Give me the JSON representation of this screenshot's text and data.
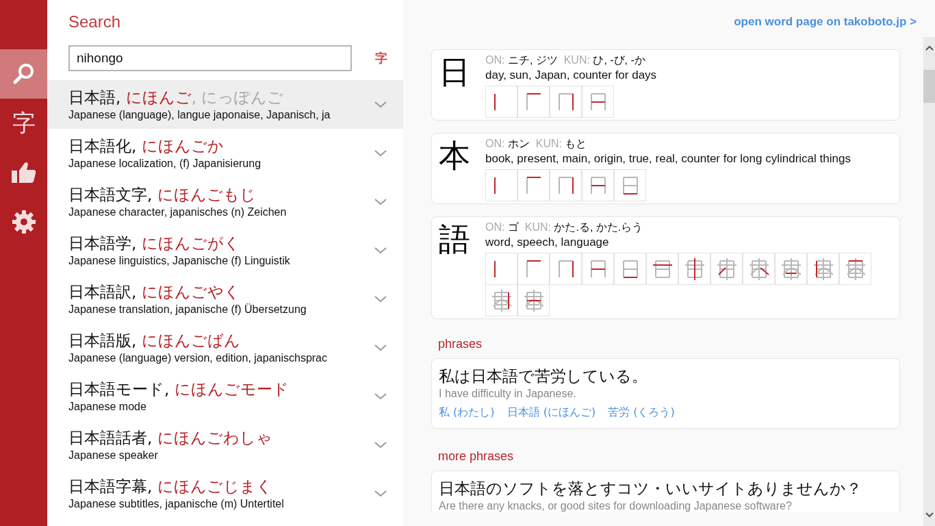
{
  "nav": [
    {
      "kind": "search",
      "selected": true
    },
    {
      "kind": "glyph",
      "label": "字",
      "selected": false
    },
    {
      "kind": "like",
      "selected": false
    },
    {
      "kind": "settings",
      "selected": false
    }
  ],
  "search": {
    "title": "Search",
    "value": "nihongo",
    "kanji_button": "字"
  },
  "results": [
    {
      "word": "日本語,",
      "reading": "にほんご",
      "alt_reading": ", にっぽんご",
      "meaning": "Japanese (language), langue japonaise, Japanisch, ja",
      "selected": true
    },
    {
      "word": "日本語化,",
      "reading": "にほんごか",
      "meaning": "Japanese localization, (f) Japanisierung",
      "selected": false
    },
    {
      "word": "日本語文字,",
      "reading": "にほんごもじ",
      "meaning": "Japanese character, japanisches (n) Zeichen",
      "selected": false
    },
    {
      "word": "日本語学,",
      "reading": "にほんごがく",
      "meaning": "Japanese linguistics, Japanische (f) Linguistik",
      "selected": false
    },
    {
      "word": "日本語訳,",
      "reading": "にほんごやく",
      "meaning": "Japanese translation, japanische (f) Übersetzung",
      "selected": false
    },
    {
      "word": "日本語版,",
      "reading": "にほんごばん",
      "meaning": "Japanese (language) version, edition, japanischsprac",
      "selected": false
    },
    {
      "word": "日本語モード,",
      "reading": "にほんごモード",
      "meaning": "Japanese mode",
      "selected": false
    },
    {
      "word": "日本語話者,",
      "reading": "にほんごわしゃ",
      "meaning": "Japanese speaker",
      "selected": false
    },
    {
      "word": "日本語字幕,",
      "reading": "にほんごじまく",
      "meaning": "Japanese subtitles, japanische (m) Untertitel",
      "selected": false
    }
  ],
  "detail": {
    "link": "open word page on takoboto.jp >",
    "kanji": [
      {
        "character": "日",
        "on_label": "ON:",
        "on": "ニチ, ジツ",
        "kun_label": "KUN:",
        "kun": "ひ, -び, -か",
        "meaning": "day, sun, Japan, counter for days",
        "strokes": [
          {
            "kind": "frame"
          },
          {
            "kind": "frame"
          },
          {
            "kind": "frame"
          },
          {
            "kind": "frame"
          }
        ]
      },
      {
        "character": "本",
        "on_label": "ON:",
        "on": "ホン",
        "kun_label": "KUN:",
        "kun": "もと",
        "meaning": "book, present, main, origin, true, real, counter for long cylindrical things",
        "strokes": [
          {
            "kind": "frame"
          },
          {
            "kind": "frame"
          },
          {
            "kind": "frame"
          },
          {
            "kind": "frame"
          },
          {
            "kind": "frame"
          }
        ]
      },
      {
        "character": "語",
        "on_label": "ON:",
        "on": "ゴ",
        "kun_label": "KUN:",
        "kun": "かた.る, かた.らう",
        "meaning": "word, speech, language",
        "strokes": [
          {
            "kind": "frame"
          },
          {
            "kind": "frame"
          },
          {
            "kind": "frame"
          },
          {
            "kind": "frame"
          },
          {
            "kind": "frame"
          },
          {
            "kind": "frame"
          },
          {
            "kind": "frame"
          },
          {
            "kind": "frame"
          },
          {
            "kind": "frame"
          },
          {
            "kind": "frame"
          },
          {
            "kind": "frame"
          },
          {
            "kind": "frame"
          },
          {
            "kind": "frame"
          },
          {
            "kind": "frame"
          }
        ]
      }
    ],
    "phrases_heading": "phrases",
    "phrases": [
      {
        "japanese": "私は日本語で苦労している。",
        "english": "I have difficulty in Japanese.",
        "words": [
          "私 (わたし)",
          "日本語 (にほんご)",
          "苦労 (くろう)"
        ]
      }
    ],
    "more_phrases_heading": "more phrases",
    "more_phrases": [
      {
        "japanese": "日本語のソフトを落とすコツ・いいサイトありませんか？",
        "english": "Are there any knacks, or good sites for downloading Japanese software?"
      }
    ]
  }
}
